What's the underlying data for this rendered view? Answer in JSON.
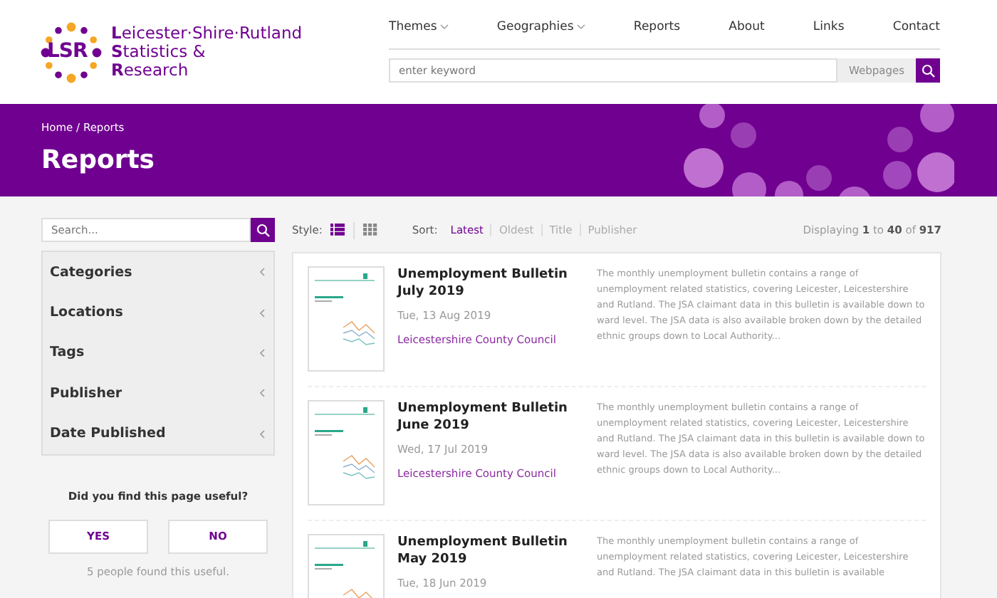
{
  "logo": {
    "mark": "LSR",
    "lines": [
      "**L**eicester·Shire·Rutland",
      "**S**tatistics &",
      "**R**esearch"
    ]
  },
  "nav": [
    {
      "label": "Themes",
      "dropdown": true
    },
    {
      "label": "Geographies",
      "dropdown": true
    },
    {
      "label": "Reports",
      "dropdown": false
    },
    {
      "label": "About",
      "dropdown": false
    },
    {
      "label": "Links",
      "dropdown": false
    },
    {
      "label": "Contact",
      "dropdown": false
    }
  ],
  "site_search": {
    "placeholder": "enter keyword",
    "scope": "Webpages"
  },
  "banner": {
    "breadcrumb": "Home / Reports",
    "title": "Reports"
  },
  "sidebar": {
    "search_placeholder": "Search...",
    "filters": [
      {
        "label": "Categories",
        "expanded": false
      },
      {
        "label": "Locations",
        "expanded": false
      },
      {
        "label": "Tags",
        "expanded": false
      },
      {
        "label": "Publisher",
        "expanded": false
      },
      {
        "label": "Date Published",
        "expanded": false
      }
    ]
  },
  "feedback": {
    "question": "Did you find this page useful?",
    "buttons": [
      "YES",
      "NO"
    ],
    "note": "5 people found this useful."
  },
  "toolbar": {
    "style_label": "Style:",
    "styles": [
      {
        "kind": "list",
        "selected": true
      },
      {
        "kind": "grid",
        "selected": false
      }
    ],
    "sort_label": "Sort:",
    "sorts": [
      {
        "label": "Latest",
        "selected": true
      },
      {
        "label": "Oldest",
        "selected": false
      },
      {
        "label": "Title",
        "selected": false
      },
      {
        "label": "Publisher",
        "selected": false
      }
    ],
    "count": "Displaying **1** to **40** of **917**"
  },
  "reports": [
    {
      "title": "Unemployment Bulletin July 2019",
      "date": "Tue, 13 Aug 2019",
      "publisher": "Leicestershire County Council",
      "summary": "The monthly unemployment bulletin contains a range of unemployment related statistics, covering Leicester, Leicestershire and Rutland. The JSA claimant data in this bulletin is available down to ward level. The JSA data is also available broken down by the detailed ethnic groups down to Local Authority..."
    },
    {
      "title": "Unemployment Bulletin June 2019",
      "date": "Wed, 17 Jul 2019",
      "publisher": "Leicestershire County Council",
      "summary": "The monthly unemployment bulletin contains a range of unemployment related statistics, covering Leicester, Leicestershire and Rutland. The JSA claimant data in this bulletin is available down to ward level. The JSA data is also available broken down by the detailed ethnic groups down to Local Authority..."
    },
    {
      "title": "Unemployment Bulletin May 2019",
      "date": "Tue, 18 Jun 2019",
      "summary": "The monthly unemployment bulletin contains a range of unemployment related statistics, covering Leicester, Leicestershire and Rutland. The JSA claimant data in this bulletin is available"
    }
  ]
}
